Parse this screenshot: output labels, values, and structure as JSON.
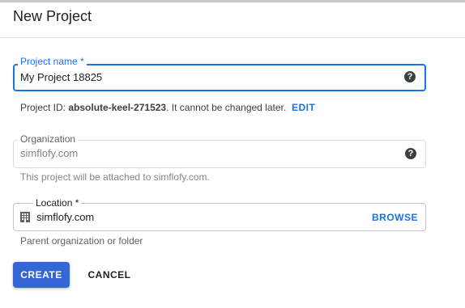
{
  "dialog": {
    "title": "New Project"
  },
  "project_name": {
    "label": "Project name *",
    "value": "My Project 18825",
    "help_icon": "help-circle-icon",
    "help_glyph": "?"
  },
  "project_id": {
    "prefix": "Project ID: ",
    "id": "absolute-keel-271523",
    "suffix": ". It cannot be changed later.",
    "edit_label": "EDIT"
  },
  "organization": {
    "label": "Organization",
    "value": "simflofy.com",
    "help_glyph": "?",
    "hint": "This project will be attached to simflofy.com."
  },
  "location": {
    "label": "Location *",
    "value": "simflofy.com",
    "icon": "building-icon",
    "browse_label": "BROWSE",
    "hint": "Parent organization or folder"
  },
  "actions": {
    "create_label": "CREATE",
    "cancel_label": "CANCEL"
  },
  "colors": {
    "accent": "#1a73e8",
    "primary_button": "#3367d6"
  }
}
